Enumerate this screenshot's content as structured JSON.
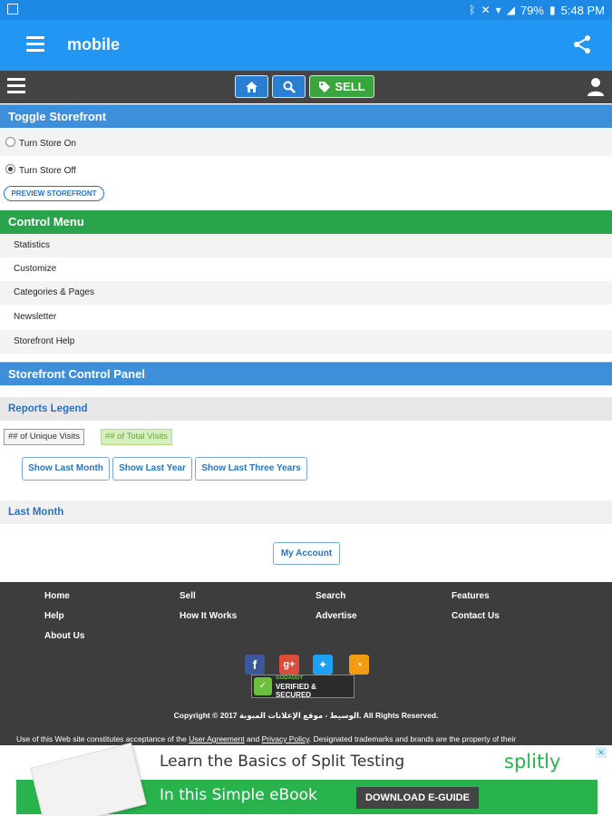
{
  "status_bar": {
    "battery": "79%",
    "time": "5:48 PM"
  },
  "app_bar": {
    "title": "mobile"
  },
  "toolbar": {
    "sell_label": "SELL"
  },
  "toggle_storefront": {
    "header": "Toggle Storefront",
    "options": [
      "Turn Store On",
      "Turn Store Off"
    ],
    "selected": "Turn Store Off",
    "preview_label": "PREVIEW STOREFRONT"
  },
  "control_menu": {
    "header": "Control Menu",
    "items": [
      "Statistics",
      "Customize",
      "Categories & Pages",
      "Newsletter",
      "Storefront Help"
    ]
  },
  "control_panel": {
    "header": "Storefront Control Panel"
  },
  "reports": {
    "legend_header": "Reports Legend",
    "legend_unique": "## of Unique Visits",
    "legend_total": "## of Total Visits",
    "buttons": [
      "Show Last Month",
      "Show Last Year",
      "Show Last Three Years"
    ],
    "last_month_header": "Last Month",
    "account_button": "My Account"
  },
  "footer": {
    "links": [
      "Home",
      "Sell",
      "Search",
      "Features",
      "Help",
      "How It Works",
      "Advertise",
      "Contact Us",
      "About Us"
    ],
    "verified_line1": "VERIFIED & SECURED",
    "verified_line2": "GODADDY",
    "copyright": "Copyright © 2017 الوسيط - موقع الإعلانات المبوبة. All Rights Reserved.",
    "terms_prefix": "Use of this Web site constitutes acceptance of the ",
    "terms_link1": "User Agreement",
    "terms_and": " and ",
    "terms_link2": "Privacy Policy",
    "terms_suffix": ". Designated trademarks and brands are the property of their"
  },
  "ad": {
    "headline": "Learn the Basics of Split Testing",
    "sub": "In this Simple eBook",
    "brand": "splitly",
    "cta": "DOWNLOAD E-GUIDE"
  },
  "colors": {
    "app_bar": "#2196f3",
    "toolbar": "#444444",
    "header_blue": "#3d8fd9",
    "header_green": "#2aa44c",
    "footer": "#3d3d3d",
    "ad_green": "#28b34c"
  }
}
